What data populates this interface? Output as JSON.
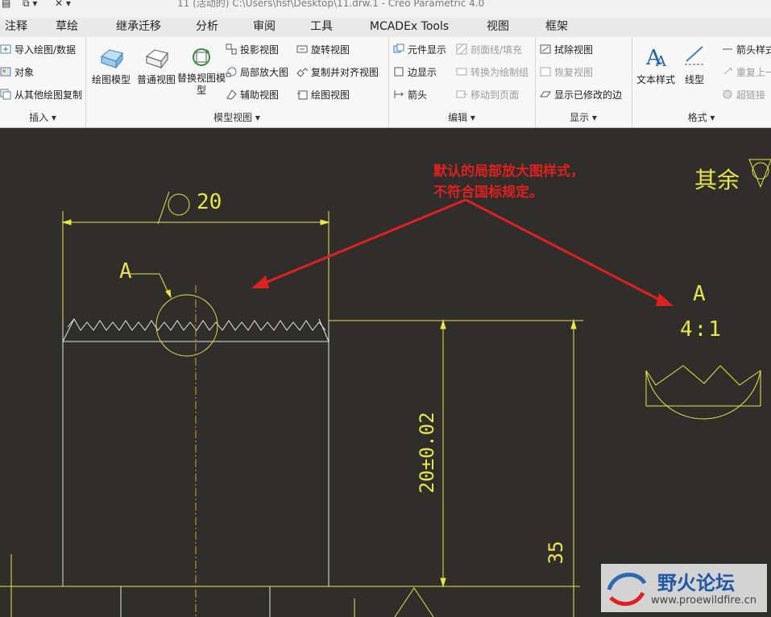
{
  "window": {
    "title": "11 (活动的) C:\\Users\\hsf\\Desktop\\11.drw.1 - Creo Parametric 4.0"
  },
  "tabs": [
    "注释",
    "草绘",
    "继承迁移",
    "分析",
    "审阅",
    "工具",
    "MCADEx Tools",
    "视图",
    "框架"
  ],
  "ribbon": {
    "insert": {
      "label": "插入",
      "items": [
        "导入绘图/数据",
        "对象",
        "从其他绘图复制"
      ]
    },
    "model_views": {
      "label": "模型视图",
      "big": [
        "绘图模型",
        "普通视图",
        "替换视图模型"
      ],
      "col1": [
        "投影视图",
        "局部放大图",
        "辅助视图"
      ],
      "col2": [
        "旋转视图",
        "复制并对齐视图",
        "绘图视图"
      ]
    },
    "edit": {
      "label": "编辑",
      "col1": [
        "元件显示",
        "边显示",
        "箭头"
      ],
      "col2": [
        "剖面线/填充",
        "转换为绘制组",
        "移动到页面"
      ]
    },
    "display": {
      "label": "显示",
      "items": [
        "拭除视图",
        "恢复视图",
        "显示已修改的边"
      ]
    },
    "format": {
      "label": "格式",
      "big": [
        "文本样式",
        "线型"
      ],
      "items": [
        "箭头样式",
        "重复上一",
        "超链接"
      ]
    }
  },
  "drawing": {
    "note_line1": "默认的局部放大图样式，",
    "note_line2": "不符合国标规定。",
    "surface_note": "其余",
    "diameter_dim": "20",
    "callout_letter": "A",
    "detail_letter": "A",
    "detail_scale": "4:1",
    "tolerance_dim": "20±0.02",
    "height_dim": "35"
  },
  "watermark": {
    "name": "野火论坛",
    "url": "www.proewildfire.cn"
  },
  "colors": {
    "canvas": "#2f2e2a",
    "cad_line": "#e8e64a",
    "annotation": "#e02020"
  }
}
